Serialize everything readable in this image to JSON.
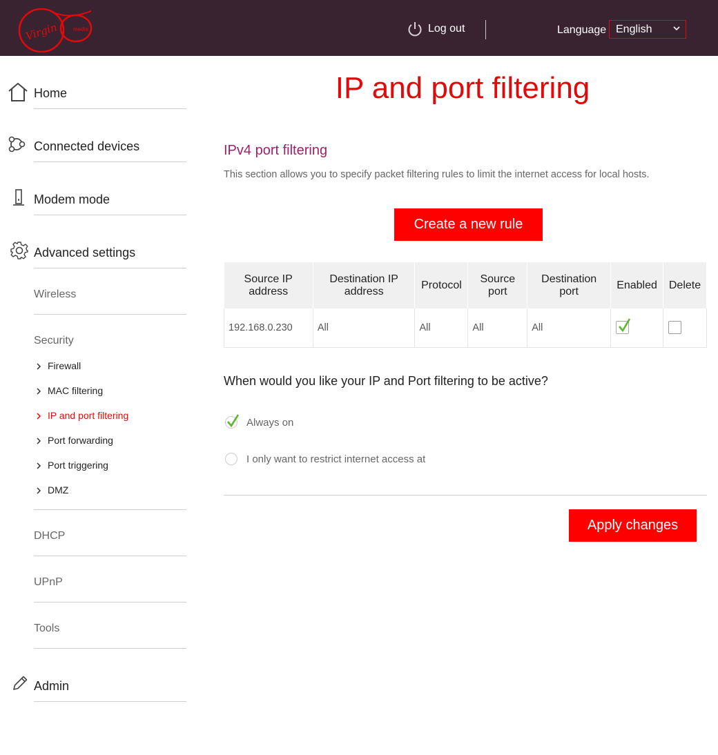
{
  "header": {
    "logo_text": "Virgin media",
    "logout_label": "Log out",
    "language_label": "Language",
    "language_selected": "English"
  },
  "sidebar": {
    "home": "Home",
    "connected_devices": "Connected devices",
    "modem_mode": "Modem mode",
    "advanced_settings": "Advanced settings",
    "wireless": "Wireless",
    "security": "Security",
    "security_items": [
      "Firewall",
      "MAC filtering",
      "IP and port filtering",
      "Port forwarding",
      "Port triggering",
      "DMZ"
    ],
    "dhcp": "DHCP",
    "upnp": "UPnP",
    "tools": "Tools",
    "admin": "Admin"
  },
  "main": {
    "page_title": "IP and port filtering",
    "section_title": "IPv4 port filtering",
    "section_desc": "This section allows you to specify packet filtering rules to limit the internet access for local hosts.",
    "create_button": "Create a new rule",
    "table": {
      "headers": [
        "Source IP address",
        "Destination IP address",
        "Protocol",
        "Source port",
        "Destination port",
        "Enabled",
        "Delete"
      ],
      "rows": [
        {
          "source_ip": "192.168.0.230",
          "destination_ip": "All",
          "protocol": "All",
          "source_port": "All",
          "destination_port": "All",
          "enabled": true,
          "delete": false
        }
      ]
    },
    "question": "When would you like your IP and Port filtering to be active?",
    "options": [
      "Always on",
      "I only want to restrict internet access at"
    ],
    "selected_option": "Always on",
    "apply_button": "Apply changes"
  },
  "colors": {
    "brand_red": "#e10a0a",
    "header_bg": "#3a2330",
    "section_title": "#a0206a",
    "check_green": "#5cb82e"
  }
}
